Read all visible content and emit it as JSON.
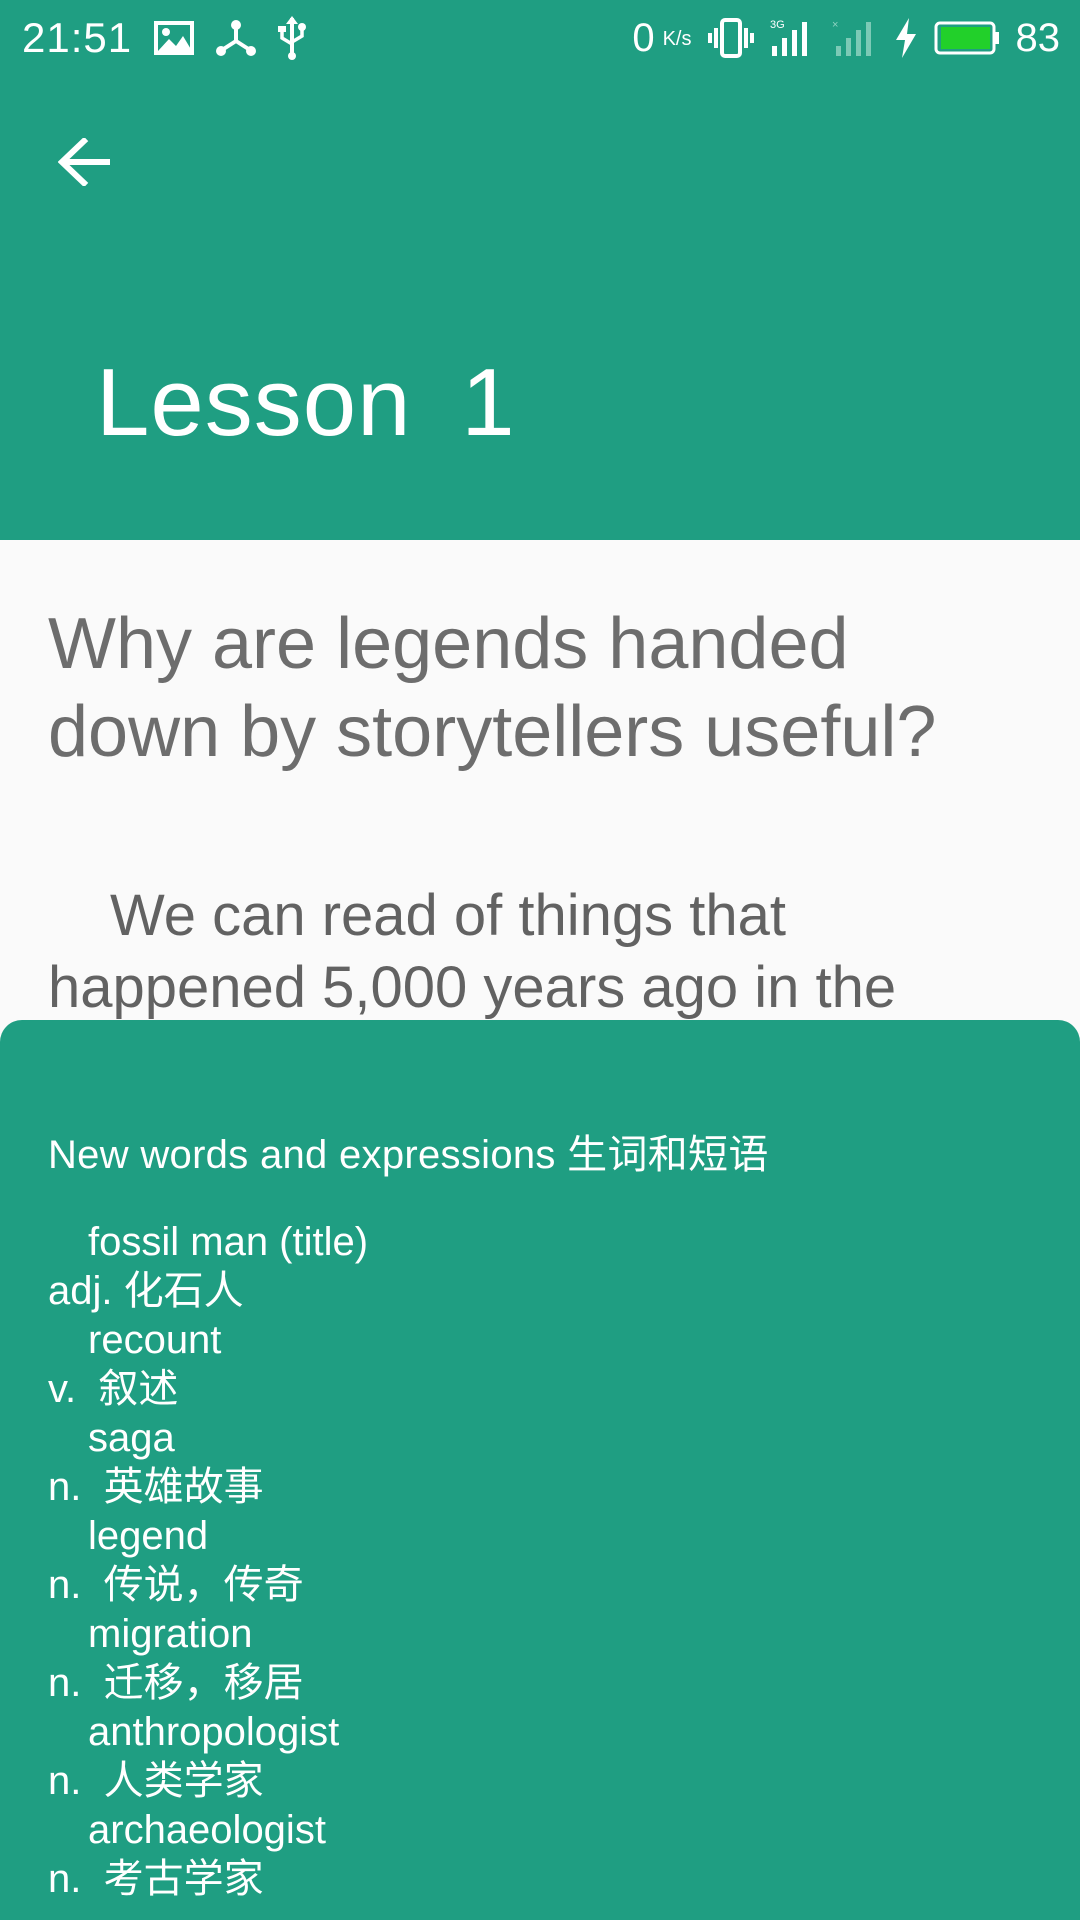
{
  "status_bar": {
    "time": "21:51",
    "net_speed": "0",
    "net_speed_unit": "K/s",
    "battery_level": "83",
    "icons": [
      "image-icon",
      "usb-tether-icon",
      "usb-icon",
      "vibrate-icon",
      "signal-3g-icon",
      "signal-empty-icon",
      "charging-icon",
      "battery-icon"
    ]
  },
  "header": {
    "back_icon": "arrow-left-icon",
    "title": "Lesson  1"
  },
  "content": {
    "question": "Why are legends handed down by storytellers useful?",
    "paragraph": "We can read of things that happened 5,000 years ago in the"
  },
  "sheet": {
    "title": "New words and expressions 生词和短语",
    "words": [
      {
        "term": "fossil man (title)",
        "definition": "adj. 化石人"
      },
      {
        "term": "recount",
        "definition": "v.  叙述"
      },
      {
        "term": "saga",
        "definition": "n.  英雄故事"
      },
      {
        "term": "legend",
        "definition": "n.  传说，传奇"
      },
      {
        "term": "migration",
        "definition": "n.  迁移，移居"
      },
      {
        "term": "anthropologist",
        "definition": "n.  人类学家"
      },
      {
        "term": "archaeologist",
        "definition": "n.  考古学家"
      }
    ]
  },
  "colors": {
    "primary": "#1f9e82",
    "background": "#fafafa",
    "text_gray": "#6d6d6d",
    "battery_fill": "#22d02a"
  }
}
